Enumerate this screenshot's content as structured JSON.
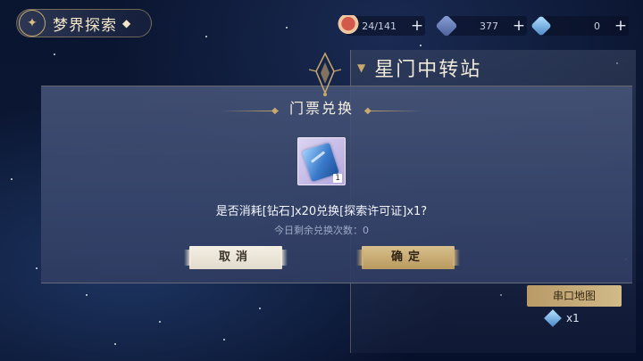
{
  "header": {
    "title": "梦界探索",
    "icon": "compass-emblem-icon"
  },
  "resources": [
    {
      "icon": "cake-icon",
      "value": "24/141"
    },
    {
      "icon": "gem-icon",
      "value": "377"
    },
    {
      "icon": "crystal-icon",
      "value": "0"
    }
  ],
  "station": {
    "title": "星门中转站",
    "map_label": "串口地图",
    "map_count": "x1"
  },
  "dialog": {
    "title": "门票兑换",
    "item": {
      "icon": "ticket-icon",
      "quantity": "1"
    },
    "question": "是否消耗[钻石]x20兑换[探索许可证]x1?",
    "remaining": "今日剩余兑换次数：0",
    "cancel_label": "取消",
    "confirm_label": "确定"
  },
  "colors": {
    "gold": "#c9a96b",
    "modal": "#46547a",
    "confirm": "#c6aa72"
  }
}
